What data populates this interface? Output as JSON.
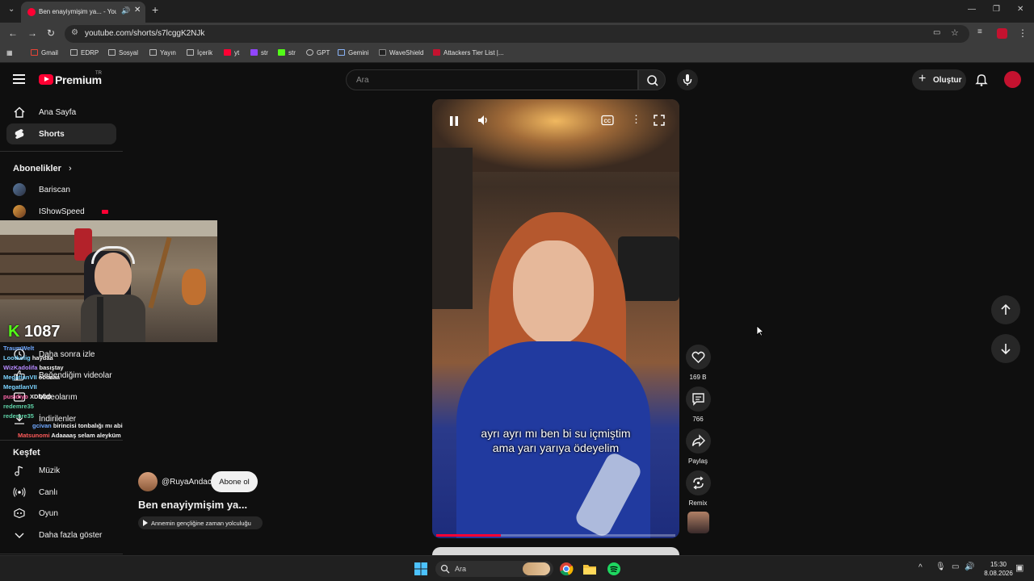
{
  "browser": {
    "tab_title": "Ben enayiymişim ya... - You",
    "url": "youtube.com/shorts/s7lcggK2NJk",
    "bookmarks": [
      "Gmail",
      "EDRP",
      "Sosyal",
      "Yayın",
      "İçerik",
      "yt",
      "str",
      "str",
      "GPT",
      "Gemini",
      "WaveShield",
      "Attackers Tier List |..."
    ]
  },
  "header": {
    "logo_text": "Premium",
    "logo_region": "TR",
    "search_placeholder": "Ara",
    "create_label": "Oluştur"
  },
  "sidebar": {
    "main": [
      {
        "label": "Ana Sayfa",
        "icon": "home-icon"
      },
      {
        "label": "Shorts",
        "icon": "shorts-icon"
      }
    ],
    "subscriptions_title": "Abonelikler",
    "subscriptions": [
      {
        "label": "Bariscan"
      },
      {
        "label": "IShowSpeed"
      }
    ],
    "you_items": [
      {
        "label": "Daha sonra izle",
        "icon": "clock-icon"
      },
      {
        "label": "Beğendiğim videolar",
        "icon": "like-icon"
      },
      {
        "label": "Videolarım",
        "icon": "video-icon"
      },
      {
        "label": "İndirilenler",
        "icon": "download-icon"
      }
    ],
    "explore_title": "Keşfet",
    "explore": [
      {
        "label": "Müzik",
        "icon": "music-icon"
      },
      {
        "label": "Canlı",
        "icon": "live-icon"
      },
      {
        "label": "Oyun",
        "icon": "gaming-icon"
      },
      {
        "label": "Daha fazla göster",
        "icon": "chevron-down-icon"
      }
    ]
  },
  "stream_overlay": {
    "counter": "1087",
    "chat": [
      {
        "user": "TraumWelt",
        "msg": "",
        "color": "#6fa8ff"
      },
      {
        "user": "Lootkolig",
        "msg": "haydaa",
        "color": "#7bd3ff"
      },
      {
        "user": "WizKadolifa",
        "msg": "basıştay",
        "color": "#b68aff"
      },
      {
        "user": "MegatlanVII",
        "msg": "obbaaa",
        "color": "#7bd3ff"
      },
      {
        "user": "MegatlanVII",
        "msg": "",
        "color": "#7bd3ff"
      },
      {
        "user": "pusidiyo",
        "msg": "XDDDD",
        "color": "#ff66aa"
      },
      {
        "user": "redemre35",
        "msg": "",
        "color": "#5fd3a8"
      },
      {
        "user": "redemre35",
        "msg": "",
        "color": "#5fd3a8"
      },
      {
        "user": "gcivan",
        "msg": "birincisi tonbalığı mı abi",
        "color": "#6fa8ff"
      },
      {
        "user": "Matsunomi",
        "msg": "Adaaaaş selam aleyküm",
        "color": "#ff5a5a"
      }
    ]
  },
  "video": {
    "caption_line1": "ayrı ayrı mı ben bi su içmiştim",
    "caption_line2": "ama yarı yarıya ödeyelim",
    "progress": 0.27
  },
  "actions": {
    "likes": "169 B",
    "comments": "766",
    "share_label": "Paylaş",
    "remix_label": "Remix"
  },
  "channel": {
    "name": "@RuyaAndac",
    "subscribe_label": "Abone ol",
    "title": "Ben enayiymişim ya...",
    "playlist_chip": "Annemin gençliğine zaman yolculuğu"
  },
  "taskbar": {
    "search_placeholder": "Ara",
    "time": "15:30",
    "date": "8.08.2026"
  },
  "colors": {
    "accent": "#ff0033",
    "background": "#0f0f0f"
  }
}
